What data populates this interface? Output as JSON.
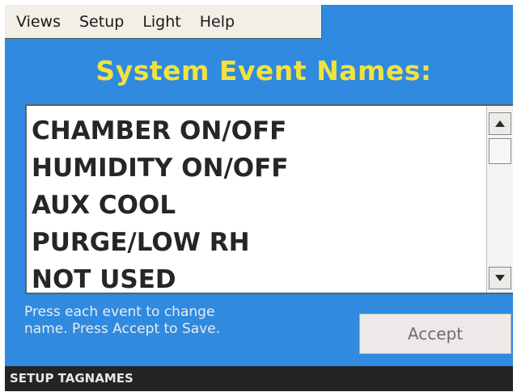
{
  "menu": {
    "items": [
      "Views",
      "Setup",
      "Light",
      "Help"
    ]
  },
  "page": {
    "title": "System Event Names:"
  },
  "events": {
    "items": [
      "CHAMBER ON/OFF",
      "HUMIDITY ON/OFF",
      "AUX COOL",
      "PURGE/LOW RH",
      "NOT USED"
    ]
  },
  "scrollbar": {
    "up_icon": "triangle-up-icon",
    "down_icon": "triangle-down-icon"
  },
  "hint": {
    "line1": "Press each event to change",
    "line2": "name. Press Accept to Save."
  },
  "buttons": {
    "accept_label": "Accept"
  },
  "status": {
    "text": "SETUP TAGNAMES"
  },
  "colors": {
    "panel_background": "#2f8ae0",
    "title_text": "#f2e23d",
    "status_bar": "#262422"
  }
}
